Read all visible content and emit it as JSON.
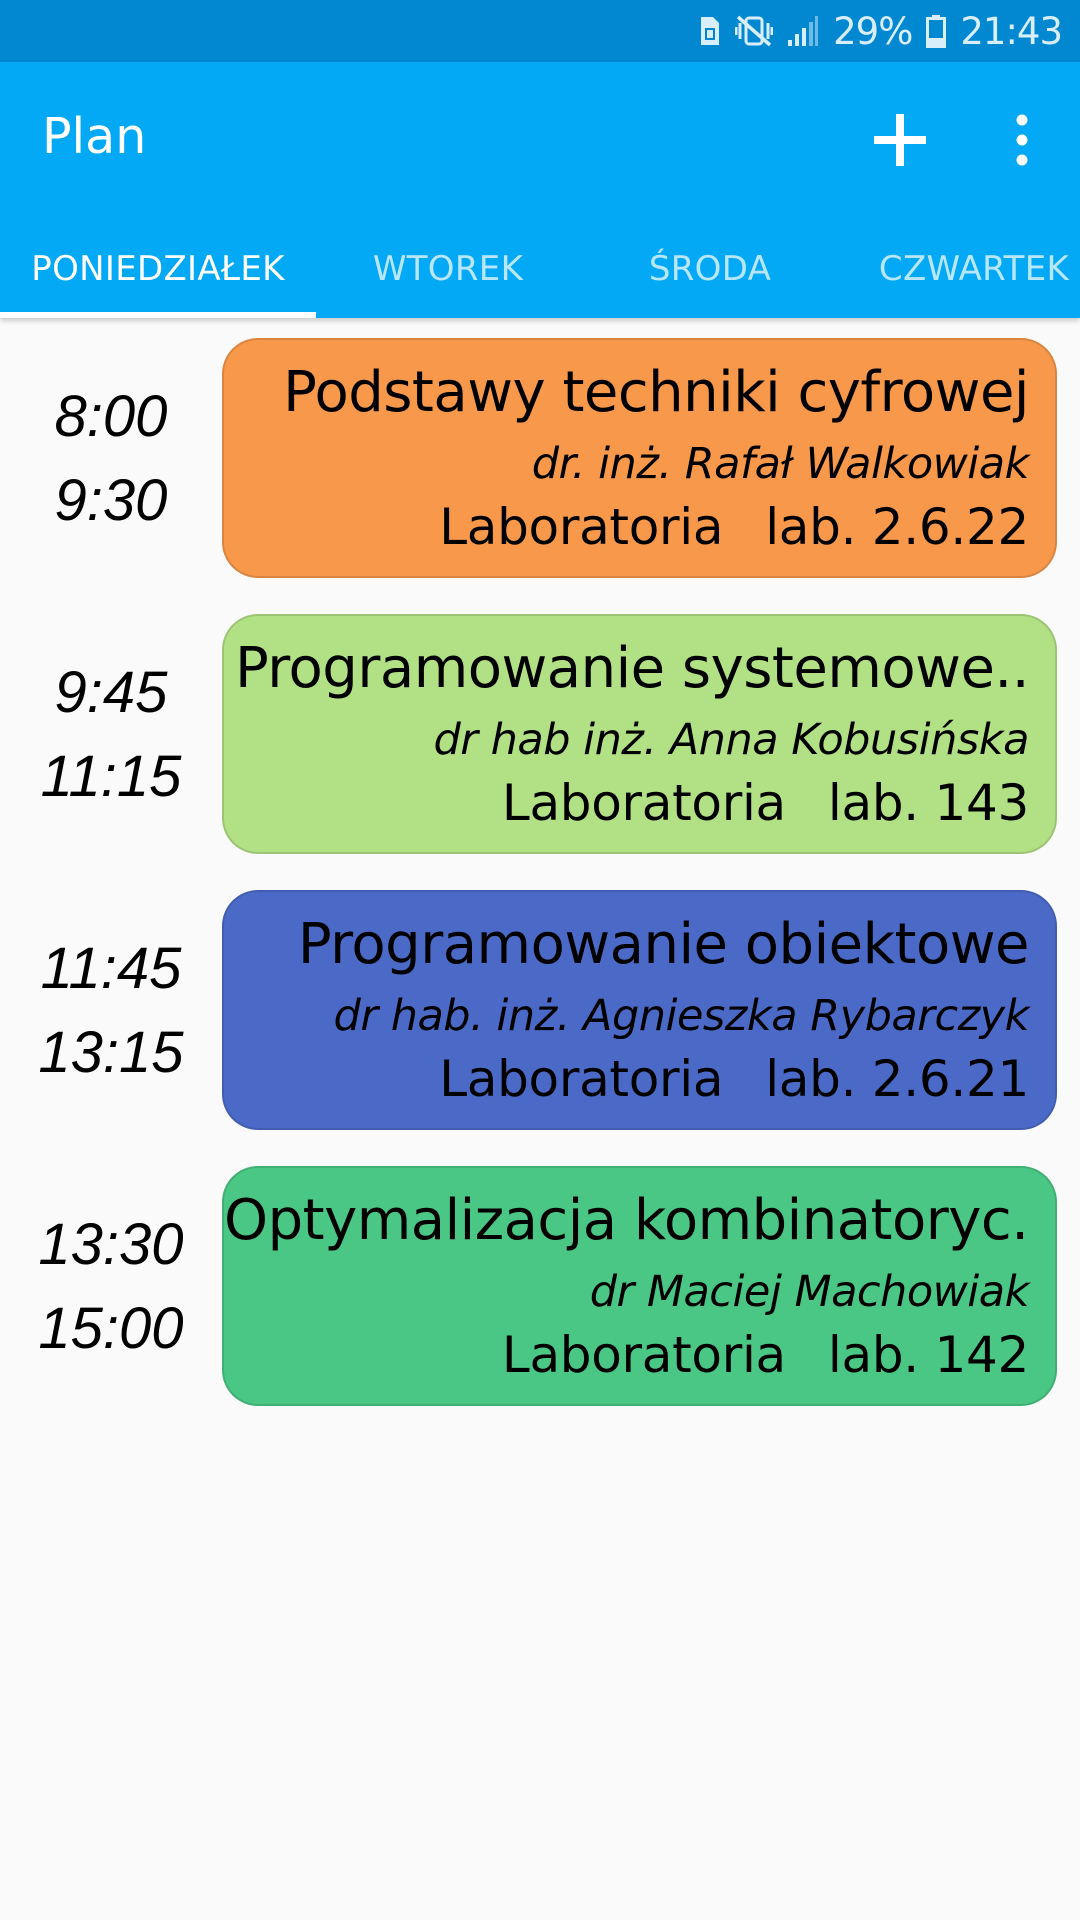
{
  "status_bar": {
    "icons": [
      "sim-card-icon",
      "vibrate-mute-icon",
      "signal-icon",
      "battery-icon"
    ],
    "battery": "29%",
    "time": "21:43"
  },
  "app_bar": {
    "title": "Plan",
    "add_icon": "plus-icon",
    "menu_icon": "more-vert-icon",
    "color": "#03a9f4"
  },
  "tabs": [
    {
      "label": "PONIEDZIAŁEK",
      "active": true
    },
    {
      "label": "WTOREK",
      "active": false
    },
    {
      "label": "ŚRODA",
      "active": false
    },
    {
      "label": "CZWARTEK",
      "active": false
    }
  ],
  "classes": [
    {
      "start": "8:00",
      "end": "9:30",
      "title": "Podstawy techniki cyfrowej",
      "teacher": "dr. inż. Rafał Walkowiak",
      "type": "Laboratoria",
      "room": "lab. 2.6.22",
      "color": "#f8984a"
    },
    {
      "start": "9:45",
      "end": "11:15",
      "title": "Programowanie systemowe..",
      "teacher": "dr hab inż. Anna Kobusińska",
      "type": "Laboratoria",
      "room": "lab. 143",
      "color": "#b2e085"
    },
    {
      "start": "11:45",
      "end": "13:15",
      "title": "Programowanie obiektowe",
      "teacher": "dr hab. inż. Agnieszka Rybarczyk",
      "type": "Laboratoria",
      "room": "lab. 2.6.21",
      "color": "#4b6ac8"
    },
    {
      "start": "13:30",
      "end": "15:00",
      "title": "Optymalizacja kombinatoryc..",
      "teacher": "dr Maciej Machowiak",
      "type": "Laboratoria",
      "room": "lab. 142",
      "color": "#4ac784"
    }
  ]
}
